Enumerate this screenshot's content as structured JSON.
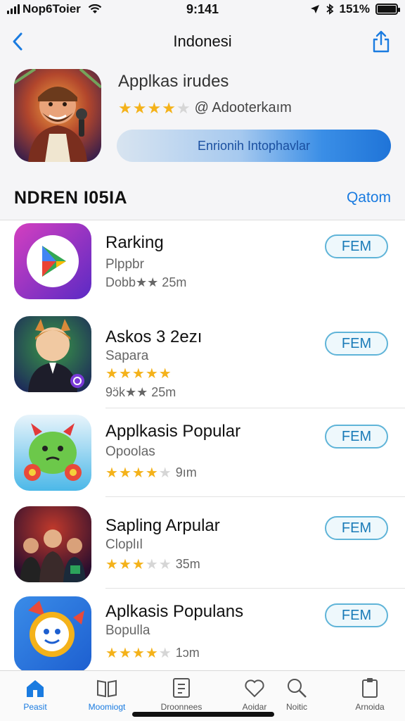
{
  "status_bar": {
    "carrier": "Nop6Toier",
    "time": "9:141",
    "battery": "151%"
  },
  "nav": {
    "title": "Indonesi"
  },
  "featured": {
    "name": "Applkas irudes",
    "rating_text": "@ Adooterkaım",
    "stars": 4,
    "cta_label": "Enrionih Intophavlar"
  },
  "section": {
    "title": "NDREN I05IA",
    "link": "Qatom"
  },
  "apps": [
    {
      "name": "Rarking",
      "subtitle": "Plppbr",
      "meta": "Dobb★★ 25m",
      "stars": 0,
      "button": "FEM",
      "icon": "play-store-icon"
    },
    {
      "name": "Askos 3 2ezı",
      "subtitle": "Sapara",
      "meta": "9ɔ̈k★★ 25m",
      "stars": 5,
      "button": "FEM",
      "icon": "fox-character-icon"
    },
    {
      "name": "Applkasis Popular",
      "subtitle": "Opoolas",
      "meta": "9ım",
      "stars": 4,
      "button": "FEM",
      "icon": "green-monster-icon"
    },
    {
      "name": "Sapling Arpular",
      "subtitle": "Cloplıl",
      "meta": "35m",
      "stars": 3,
      "button": "FEM",
      "icon": "band-poster-icon"
    },
    {
      "name": "Aplkasis Populans",
      "subtitle": "Bopulla",
      "meta": "1ɔm",
      "stars": 4,
      "button": "FEM",
      "icon": "smiley-chat-icon"
    }
  ],
  "tabs": [
    {
      "label": "Peasit",
      "icon": "home-icon",
      "active": true
    },
    {
      "label": "Moomiogt",
      "icon": "book-icon",
      "active": false
    },
    {
      "label": "Droonnees",
      "icon": "document-icon",
      "active": false
    },
    {
      "label": "Aoidar",
      "icon": "heart-icon",
      "active": false
    },
    {
      "label": "Noitic",
      "icon": "search-icon",
      "active": false
    },
    {
      "label": "Arnoida",
      "icon": "clipboard-icon",
      "active": false
    }
  ],
  "colors": {
    "accent": "#1a7be0",
    "star": "#f4b21a",
    "button_border": "#5fb4d8"
  }
}
